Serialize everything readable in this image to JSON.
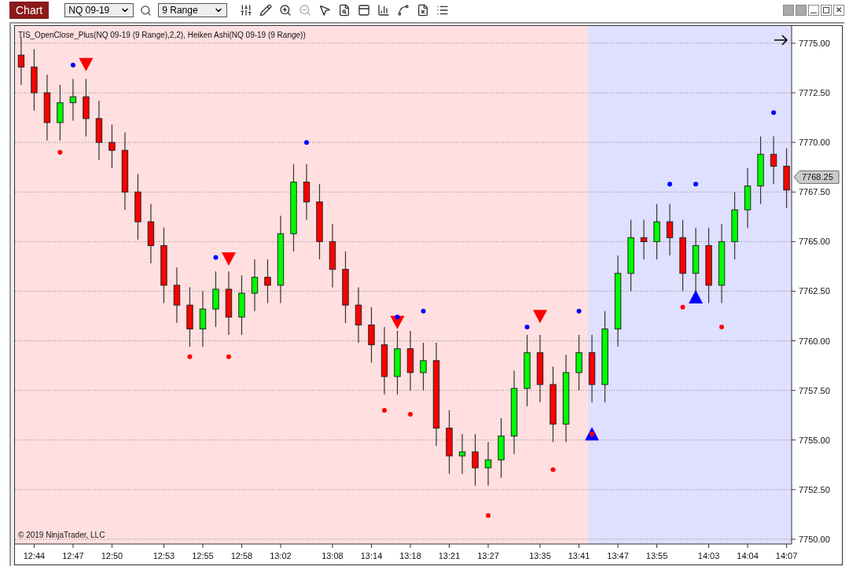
{
  "toolbar": {
    "title_button": "Chart",
    "instrument": "NQ 09-19",
    "interval": "9 Range",
    "close_glyph": "✕"
  },
  "chart": {
    "indicator_label": "TIS_OpenClose_Plus(NQ 09-19 (9 Range),2,2), Heiken Ashi(NQ 09-19 (9 Range))",
    "copyright": "© 2019 NinjaTrader, LLC",
    "last_price": "7768.25",
    "chart_data": {
      "type": "candlestick",
      "grid": true,
      "ylim": [
        7749.76,
        7775.87
      ],
      "categories": [
        null,
        "12:44",
        null,
        null,
        "12:47",
        null,
        null,
        "12:50",
        null,
        null,
        null,
        "12:53",
        null,
        null,
        "12:55",
        null,
        null,
        "12:58",
        null,
        null,
        "13:02",
        null,
        null,
        null,
        "13:08",
        null,
        null,
        "13:14",
        null,
        null,
        "13:18",
        null,
        null,
        "13:21",
        null,
        null,
        "13:27",
        null,
        null,
        null,
        "13:35",
        null,
        null,
        "13:41",
        null,
        null,
        "13:47",
        null,
        null,
        "13:55",
        null,
        null,
        null,
        "14:03",
        null,
        null,
        "14:04",
        null,
        null,
        "14:07"
      ],
      "ohlc": [
        [
          7774.4,
          7775.3,
          7772.9,
          7773.8
        ],
        [
          7773.8,
          7774.7,
          7771.6,
          7772.5
        ],
        [
          7772.5,
          7773.4,
          7770.1,
          7771.0
        ],
        [
          7771.0,
          7772.9,
          7770.1,
          7772.0
        ],
        [
          7772.0,
          7773.2,
          7771.1,
          7772.3
        ],
        [
          7772.3,
          7773.2,
          7770.3,
          7771.2
        ],
        [
          7771.2,
          7772.1,
          7769.1,
          7770.0
        ],
        [
          7770.0,
          7770.9,
          7768.7,
          7769.6
        ],
        [
          7769.6,
          7770.5,
          7766.6,
          7767.5
        ],
        [
          7767.5,
          7768.4,
          7765.1,
          7766.0
        ],
        [
          7766.0,
          7766.9,
          7763.9,
          7764.8
        ],
        [
          7764.8,
          7765.7,
          7761.9,
          7762.8
        ],
        [
          7762.8,
          7763.7,
          7760.9,
          7761.8
        ],
        [
          7761.8,
          7762.7,
          7759.7,
          7760.6
        ],
        [
          7760.6,
          7762.5,
          7759.7,
          7761.6
        ],
        [
          7761.6,
          7763.5,
          7760.7,
          7762.6
        ],
        [
          7762.6,
          7763.5,
          7760.3,
          7761.2
        ],
        [
          7761.2,
          7763.3,
          7760.3,
          7762.4
        ],
        [
          7762.4,
          7764.1,
          7761.5,
          7763.2
        ],
        [
          7763.2,
          7764.1,
          7761.9,
          7762.8
        ],
        [
          7762.8,
          7766.3,
          7761.9,
          7765.4
        ],
        [
          7765.4,
          7768.9,
          7764.5,
          7768.0
        ],
        [
          7768.0,
          7768.9,
          7766.1,
          7767.0
        ],
        [
          7767.0,
          7767.9,
          7764.1,
          7765.0
        ],
        [
          7765.0,
          7765.9,
          7762.7,
          7763.6
        ],
        [
          7763.6,
          7764.5,
          7760.9,
          7761.8
        ],
        [
          7761.8,
          7762.7,
          7759.9,
          7760.8
        ],
        [
          7760.8,
          7761.7,
          7758.9,
          7759.8
        ],
        [
          7759.8,
          7760.7,
          7757.3,
          7758.2
        ],
        [
          7758.2,
          7760.5,
          7757.3,
          7759.6
        ],
        [
          7759.6,
          7760.5,
          7757.5,
          7758.4
        ],
        [
          7758.4,
          7759.9,
          7757.5,
          7759.0
        ],
        [
          7759.0,
          7759.9,
          7754.7,
          7755.6
        ],
        [
          7755.6,
          7756.5,
          7753.3,
          7754.2
        ],
        [
          7754.2,
          7755.3,
          7753.3,
          7754.4
        ],
        [
          7754.4,
          7755.3,
          7752.7,
          7753.6
        ],
        [
          7753.6,
          7754.9,
          7752.7,
          7754.0
        ],
        [
          7754.0,
          7756.1,
          7753.1,
          7755.2
        ],
        [
          7755.2,
          7758.5,
          7754.3,
          7757.6
        ],
        [
          7757.6,
          7760.3,
          7756.7,
          7759.4
        ],
        [
          7759.4,
          7760.3,
          7756.9,
          7757.8
        ],
        [
          7757.8,
          7758.7,
          7754.9,
          7755.8
        ],
        [
          7755.8,
          7759.3,
          7754.9,
          7758.4
        ],
        [
          7758.4,
          7760.3,
          7757.5,
          7759.4
        ],
        [
          7759.4,
          7760.3,
          7756.9,
          7757.8
        ],
        [
          7757.8,
          7761.5,
          7756.9,
          7760.6
        ],
        [
          7760.6,
          7764.3,
          7759.7,
          7763.4
        ],
        [
          7763.4,
          7766.1,
          7762.5,
          7765.2
        ],
        [
          7765.2,
          7766.1,
          7764.1,
          7765.0
        ],
        [
          7765.0,
          7766.9,
          7764.1,
          7766.0
        ],
        [
          7766.0,
          7766.9,
          7764.3,
          7765.2
        ],
        [
          7765.2,
          7766.1,
          7762.5,
          7763.4
        ],
        [
          7763.4,
          7765.7,
          7762.5,
          7764.8
        ],
        [
          7764.8,
          7765.7,
          7761.9,
          7762.8
        ],
        [
          7762.8,
          7765.9,
          7761.9,
          7765.0
        ],
        [
          7765.0,
          7767.5,
          7764.1,
          7766.6
        ],
        [
          7766.6,
          7768.7,
          7765.7,
          7767.8
        ],
        [
          7767.8,
          7770.3,
          7766.9,
          7769.4
        ],
        [
          7769.4,
          7770.3,
          7767.9,
          7768.8
        ],
        [
          7768.8,
          7769.7,
          7766.7,
          7767.6
        ]
      ],
      "yticks": [
        {
          "value": 7750,
          "label": "7750.00"
        },
        {
          "value": 7752.5,
          "label": "7752.50"
        },
        {
          "value": 7755,
          "label": "7755.00"
        },
        {
          "value": 7757.5,
          "label": "7757.50"
        },
        {
          "value": 7760,
          "label": "7760.00"
        },
        {
          "value": 7762.5,
          "label": "7762.50"
        },
        {
          "value": 7765,
          "label": "7765.00"
        },
        {
          "value": 7767.5,
          "label": "7767.50"
        },
        {
          "value": 7770,
          "label": "7770.00"
        },
        {
          "value": 7772.5,
          "label": "7772.50"
        },
        {
          "value": 7775,
          "label": "7775.00"
        }
      ],
      "series": [
        {
          "type": "scatter",
          "marker": "triangle-down",
          "color": "#ff0000",
          "values": [
            null,
            null,
            null,
            null,
            null,
            7773.9,
            null,
            null,
            null,
            null,
            null,
            null,
            null,
            null,
            null,
            null,
            7764.1,
            null,
            null,
            null,
            null,
            null,
            null,
            null,
            null,
            null,
            null,
            null,
            null,
            7760.9,
            null,
            null,
            null,
            null,
            null,
            null,
            null,
            null,
            null,
            null,
            7761.2,
            null,
            null,
            null,
            null,
            null,
            null,
            null,
            null,
            null,
            null,
            null,
            null,
            null,
            null,
            null,
            null,
            null,
            null,
            null
          ]
        },
        {
          "type": "scatter",
          "marker": "triangle-up",
          "color": "#0000ff",
          "values": [
            null,
            null,
            null,
            null,
            null,
            null,
            null,
            null,
            null,
            null,
            null,
            null,
            null,
            null,
            null,
            null,
            null,
            null,
            null,
            null,
            null,
            null,
            null,
            null,
            null,
            null,
            null,
            null,
            null,
            null,
            null,
            null,
            null,
            null,
            null,
            null,
            null,
            null,
            null,
            null,
            null,
            null,
            null,
            null,
            7755.3,
            null,
            null,
            null,
            null,
            null,
            null,
            null,
            7762.2,
            null,
            null,
            null,
            null,
            null,
            null,
            null
          ]
        },
        {
          "type": "scatter",
          "marker": "circle",
          "color": "#0000ff",
          "values": [
            null,
            null,
            null,
            null,
            7773.9,
            null,
            null,
            null,
            null,
            null,
            null,
            null,
            null,
            null,
            null,
            7764.2,
            null,
            null,
            null,
            null,
            null,
            null,
            7770.0,
            null,
            null,
            null,
            null,
            null,
            null,
            7761.2,
            null,
            7761.5,
            null,
            null,
            null,
            null,
            null,
            null,
            null,
            7760.7,
            null,
            null,
            null,
            7761.5,
            null,
            null,
            null,
            null,
            null,
            null,
            7767.9,
            null,
            7767.9,
            null,
            null,
            null,
            null,
            null,
            7771.5,
            null
          ]
        },
        {
          "type": "scatter",
          "marker": "circle",
          "color": "#ff0000",
          "values": [
            null,
            null,
            null,
            7769.5,
            null,
            null,
            null,
            null,
            null,
            null,
            null,
            null,
            null,
            7759.2,
            null,
            null,
            7759.2,
            null,
            null,
            null,
            null,
            null,
            null,
            null,
            null,
            null,
            null,
            null,
            7756.5,
            null,
            7756.3,
            null,
            null,
            null,
            null,
            null,
            7751.2,
            null,
            null,
            null,
            null,
            7753.5,
            null,
            null,
            7755.3,
            null,
            null,
            null,
            null,
            null,
            null,
            7761.7,
            null,
            null,
            7760.7,
            null,
            null,
            null,
            null,
            null
          ]
        }
      ]
    }
  }
}
